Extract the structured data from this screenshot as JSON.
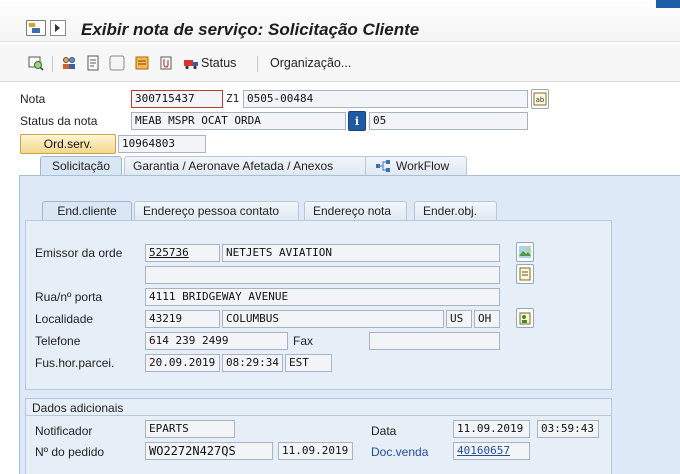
{
  "window": {
    "title": "Exibir nota de serviço: Solicitação Cliente"
  },
  "toolbar": {
    "status_label": "Status",
    "organizacao_label": "Organização..."
  },
  "header": {
    "nota_label": "Nota",
    "nota_value": "300715437",
    "nota_type": "Z1",
    "nota_desc": "0505-00484",
    "status_label": "Status da nota",
    "status_value": "MEAB MSPR OCAT ORDA",
    "status_code": "05",
    "ordserv_label": "Ord.serv.",
    "ordserv_value": "10964803"
  },
  "main_tabs": [
    {
      "label": "Solicitação",
      "active": true
    },
    {
      "label": "Garantia  / Aeronave Afetada / Anexos",
      "active": false
    },
    {
      "label": "WorkFlow",
      "active": false
    }
  ],
  "sub_tabs": [
    {
      "label": "End.cliente",
      "active": true
    },
    {
      "label": "Endereço pessoa contato",
      "active": false
    },
    {
      "label": "Endereço nota",
      "active": false
    },
    {
      "label": "Ender.obj.",
      "active": false
    }
  ],
  "cliente": {
    "emissor_label": "Emissor da orde",
    "emissor_code": "525736",
    "emissor_name": "NETJETS AVIATION",
    "name2": "",
    "rua_label": "Rua/nº porta",
    "rua_value": "4111 BRIDGEWAY AVENUE",
    "localidade_label": "Localidade",
    "cep": "43219",
    "cidade": "COLUMBUS",
    "pais": "US",
    "regiao": "OH",
    "telefone_label": "Telefone",
    "telefone_value": "614 239 2499",
    "fax_label": "Fax",
    "fax_value": "",
    "fuso_label": "Fus.hor.parcei.",
    "fuso_date": "20.09.2019",
    "fuso_time": "08:29:34",
    "fuso_zone": "EST"
  },
  "adicionais": {
    "title": "Dados adicionais",
    "notificador_label": "Notificador",
    "notificador_value": "EPARTS",
    "data_label": "Data",
    "data_value": "11.09.2019",
    "hora_value": "03:59:43",
    "pedido_label": "Nº do pedido",
    "pedido_value": "WO2272N427QS",
    "pedido_date": "11.09.2019",
    "docvenda_label": "Doc.venda",
    "docvenda_value": "40160657"
  },
  "colors": {
    "panel_bg": "#dde9f6",
    "button_bg": "#f3d88a",
    "link": "#1f4e9c"
  }
}
